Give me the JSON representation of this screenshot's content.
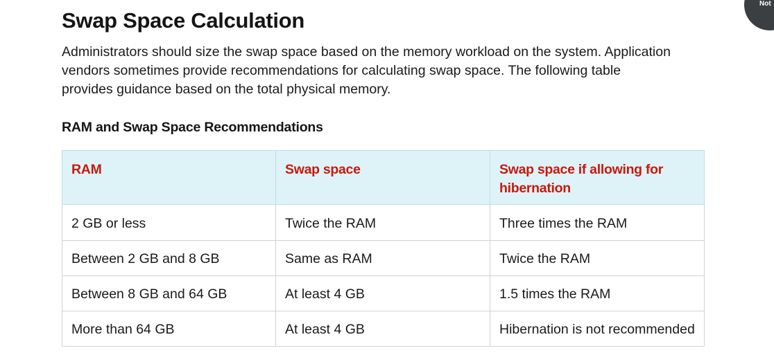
{
  "section": {
    "title": "Swap Space Calculation",
    "intro": "Administrators should size the swap space based on the memory workload on the system. Application vendors sometimes provide recommendations for calculating swap space. The following table provides guidance based on the total physical memory."
  },
  "table": {
    "caption": "RAM and Swap Space Recommendations",
    "headers": [
      "RAM",
      "Swap space",
      "Swap space if allowing for hibernation"
    ],
    "rows": [
      [
        "2 GB or less",
        "Twice the RAM",
        "Three times the RAM"
      ],
      [
        "Between 2 GB and 8 GB",
        "Same as RAM",
        "Twice the RAM"
      ],
      [
        "Between 8 GB and 64 GB",
        "At least 4 GB",
        "1.5 times the RAM"
      ],
      [
        "More than 64 GB",
        "At least 4 GB",
        "Hibernation is not recommended"
      ]
    ]
  },
  "corner_badge": {
    "label": "Not"
  },
  "colors": {
    "header_text": "#c9190b",
    "header_bg": "#def3f8",
    "border": "#d2d2d2"
  }
}
